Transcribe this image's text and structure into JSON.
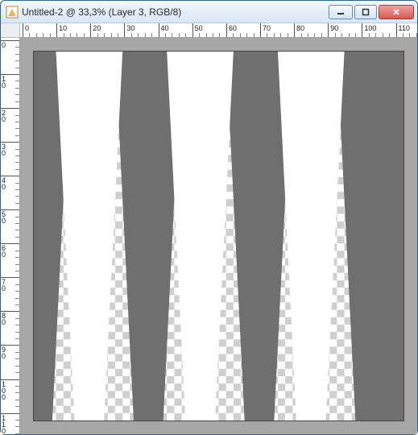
{
  "window": {
    "title": "Untitled-2 @ 33,3% (Layer 3, RGB/8)"
  },
  "controls": {
    "minimize": "–",
    "maximize": "□",
    "close": "✕"
  },
  "ruler": {
    "h_labels": [
      "0",
      "10",
      "20",
      "30",
      "40",
      "50",
      "60",
      "70",
      "80",
      "90",
      "100",
      "110"
    ],
    "v_labels": [
      "0",
      "10",
      "20",
      "30",
      "40",
      "50",
      "60",
      "70",
      "80",
      "90",
      "100",
      "110"
    ]
  },
  "canvas": {
    "gray": "#6f6f6f",
    "pasteboard": "#a7a7a7"
  }
}
